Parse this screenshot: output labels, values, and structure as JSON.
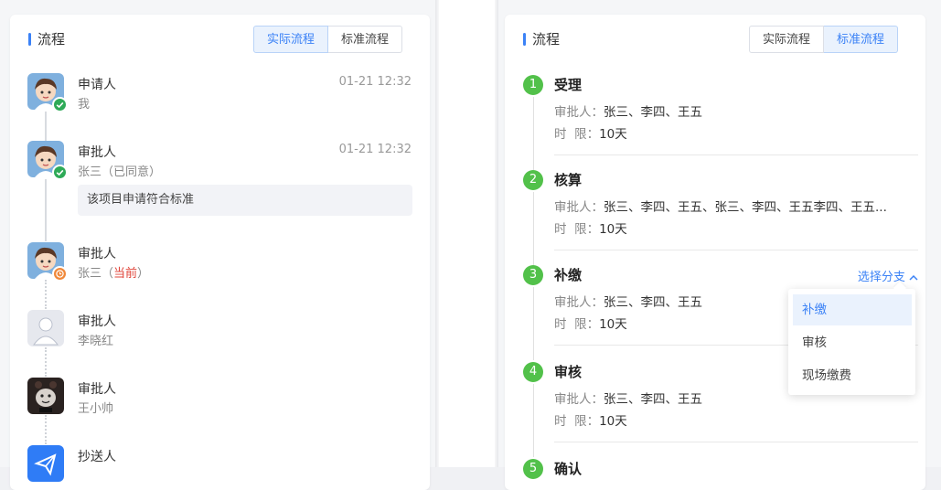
{
  "left_card": {
    "title": "流程",
    "tabs": [
      {
        "label": "实际流程",
        "active": true
      },
      {
        "label": "标准流程",
        "active": false
      }
    ],
    "items": [
      {
        "role": "申请人",
        "sub": "我",
        "time": "01-21 12:32",
        "status": "approved"
      },
      {
        "role": "审批人",
        "sub": "张三（已同意）",
        "time": "01-21 12:32",
        "status": "approved",
        "comment": "该项目申请符合标准"
      },
      {
        "role": "审批人",
        "sub_prefix": "张三（",
        "sub_highlight": "当前",
        "sub_suffix": "）",
        "status": "pending"
      },
      {
        "role": "审批人",
        "sub": "李晓红"
      },
      {
        "role": "审批人",
        "sub": "王小帅"
      },
      {
        "role": "抄送人"
      }
    ]
  },
  "right_card": {
    "title": "流程",
    "tabs": [
      {
        "label": "实际流程",
        "active": false
      },
      {
        "label": "标准流程",
        "active": true
      }
    ],
    "approver_label": "审批人：",
    "limit_label": "时  限：",
    "steps": [
      {
        "num": "1",
        "title": "受理",
        "approvers": "张三、李四、王五",
        "limit": "10天"
      },
      {
        "num": "2",
        "title": "核算",
        "approvers": "张三、李四、王五、张三、李四、王五李四、王五...",
        "limit": "10天"
      },
      {
        "num": "3",
        "title": "补缴",
        "approvers": "张三、李四、王五",
        "limit": "10天",
        "branch": "选择分支"
      },
      {
        "num": "4",
        "title": "审核",
        "approvers": "张三、李四、王五",
        "limit": "10天"
      },
      {
        "num": "5",
        "title": "确认"
      }
    ],
    "dropdown": [
      "补缴",
      "审核",
      "现场缴费"
    ],
    "dropdown_selected": "补缴"
  },
  "colors": {
    "accent": "#3b82f6",
    "success": "#52c14a",
    "pending": "#f0883a",
    "highlight": "#e0453a"
  }
}
